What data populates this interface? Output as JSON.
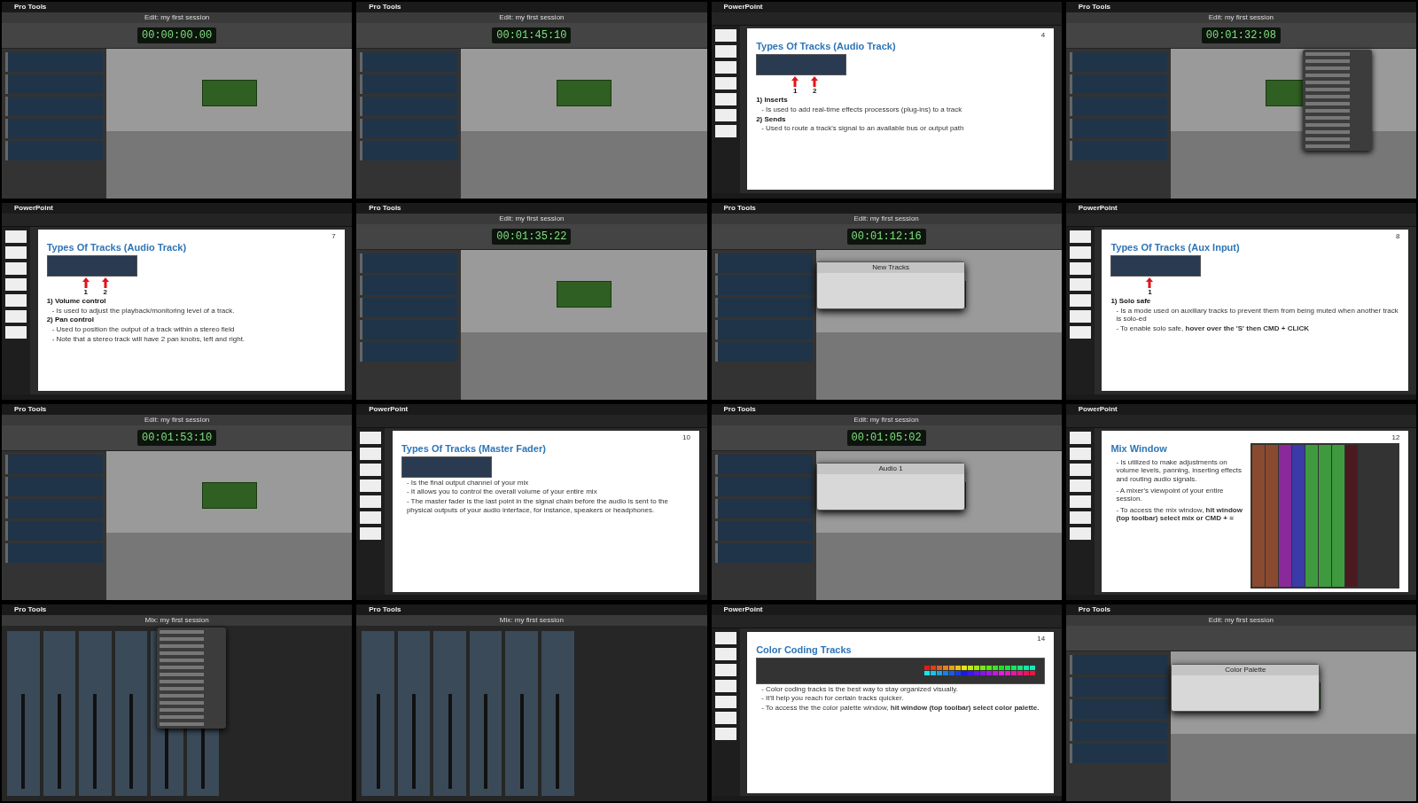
{
  "frames": [
    {
      "kind": "daw",
      "app": "Pro Tools",
      "window_title": "Edit: my first session",
      "counter": "00:00:00.00",
      "menu_open": false
    },
    {
      "kind": "daw",
      "app": "Pro Tools",
      "window_title": "Edit: my first session",
      "counter": "00:01:45:10",
      "menu_open": false
    },
    {
      "kind": "slide",
      "app": "PowerPoint",
      "slide": {
        "kind": "image-top",
        "page": "4",
        "title": "Types Of Tracks (Audio Track)",
        "markers": [
          "1",
          "2"
        ],
        "bullets": [
          {
            "kind": "heading",
            "text": "1)  Inserts"
          },
          {
            "kind": "item",
            "text": "- Is used to add real-time effects processors (plug-ins) to a track"
          },
          {
            "kind": "heading",
            "text": "2)  Sends"
          },
          {
            "kind": "item",
            "text": "- Used to route a track's signal to an available bus or output path"
          }
        ]
      }
    },
    {
      "kind": "daw",
      "app": "Pro Tools",
      "window_title": "Edit: my first session",
      "counter": "00:01:32:08",
      "menu_open": true
    },
    {
      "kind": "slide",
      "app": "PowerPoint",
      "slide": {
        "kind": "image-top",
        "page": "7",
        "title": "Types Of Tracks (Audio Track)",
        "markers": [
          "1",
          "2"
        ],
        "bullets": [
          {
            "kind": "heading",
            "text": "1)  Volume control"
          },
          {
            "kind": "item",
            "text": "- Is used to adjust the playback/monitoring level of a track."
          },
          {
            "kind": "heading",
            "text": "2)  Pan control"
          },
          {
            "kind": "item",
            "text": "- Used to position the output of a track within a stereo field"
          },
          {
            "kind": "item",
            "text": "- Note that a stereo track will have 2 pan knobs, left and right."
          }
        ]
      }
    },
    {
      "kind": "daw",
      "app": "Pro Tools",
      "window_title": "Edit: my first session",
      "counter": "00:01:35:22",
      "menu_open": false
    },
    {
      "kind": "daw",
      "app": "Pro Tools",
      "window_title": "Edit: my first session",
      "counter": "00:01:12:16",
      "menu_open": false,
      "dialog": "New Tracks"
    },
    {
      "kind": "slide",
      "app": "PowerPoint",
      "slide": {
        "kind": "image-top",
        "page": "8",
        "title": "Types Of Tracks (Aux Input)",
        "markers": [
          "1"
        ],
        "bullets": [
          {
            "kind": "heading",
            "text": "1)  Solo safe"
          },
          {
            "kind": "item",
            "text": "- Is a mode used on auxiliary tracks to prevent them from being muted when another track is solo-ed"
          },
          {
            "kind": "item",
            "text": "- To enable solo safe, **hover over the 'S' then CMD + CLICK**"
          }
        ]
      }
    },
    {
      "kind": "daw",
      "app": "Pro Tools",
      "window_title": "Edit: my first session",
      "counter": "00:01:53:10",
      "menu_open": false
    },
    {
      "kind": "slide",
      "app": "PowerPoint",
      "slide": {
        "kind": "image-top",
        "page": "10",
        "title": "Types Of Tracks (Master Fader)",
        "bullets": [
          {
            "kind": "item",
            "text": "- Is the final output channel of your mix"
          },
          {
            "kind": "item",
            "text": "- It allows you to control the overall volume of your entire mix"
          },
          {
            "kind": "item",
            "text": "- The master fader is the last point in the signal chain before the audio is sent to the physical outputs of your audio interface, for instance, speakers or headphones."
          }
        ]
      }
    },
    {
      "kind": "daw",
      "app": "Pro Tools",
      "window_title": "Edit: my first session",
      "counter": "00:01:05:02",
      "menu_open": false,
      "dialog": "Audio 1"
    },
    {
      "kind": "slide",
      "app": "PowerPoint",
      "slide": {
        "kind": "image-right",
        "page": "12",
        "title": "Mix Window",
        "bullets": [
          {
            "kind": "item",
            "text": "- Is utilized to make adjustments on volume levels, panning, inserting effects and routing audio signals."
          },
          {
            "kind": "item",
            "text": "- A mixer's viewpoint of your entire session."
          },
          {
            "kind": "item",
            "text": "- To access the mix window, **hit window (top toolbar) select mix or CMD + =**"
          }
        ]
      }
    },
    {
      "kind": "mix",
      "app": "Pro Tools",
      "window_title": "Mix: my first session",
      "menu_open": true
    },
    {
      "kind": "mix",
      "app": "Pro Tools",
      "window_title": "Mix: my first session",
      "menu_open": false
    },
    {
      "kind": "slide",
      "app": "PowerPoint",
      "slide": {
        "kind": "image-wide",
        "page": "14",
        "title": "Color Coding Tracks",
        "bullets": [
          {
            "kind": "item",
            "text": "- Color coding tracks is the best way to stay organized visually."
          },
          {
            "kind": "item",
            "text": "- It'll help you reach for certain tracks quicker."
          },
          {
            "kind": "item",
            "text": "- To access the the color palette window, **hit window (top toolbar) select color palette.**"
          }
        ]
      }
    },
    {
      "kind": "daw",
      "app": "Pro Tools",
      "window_title": "Edit: my first session",
      "menu_open": false,
      "dialog": "Color Palette"
    }
  ]
}
